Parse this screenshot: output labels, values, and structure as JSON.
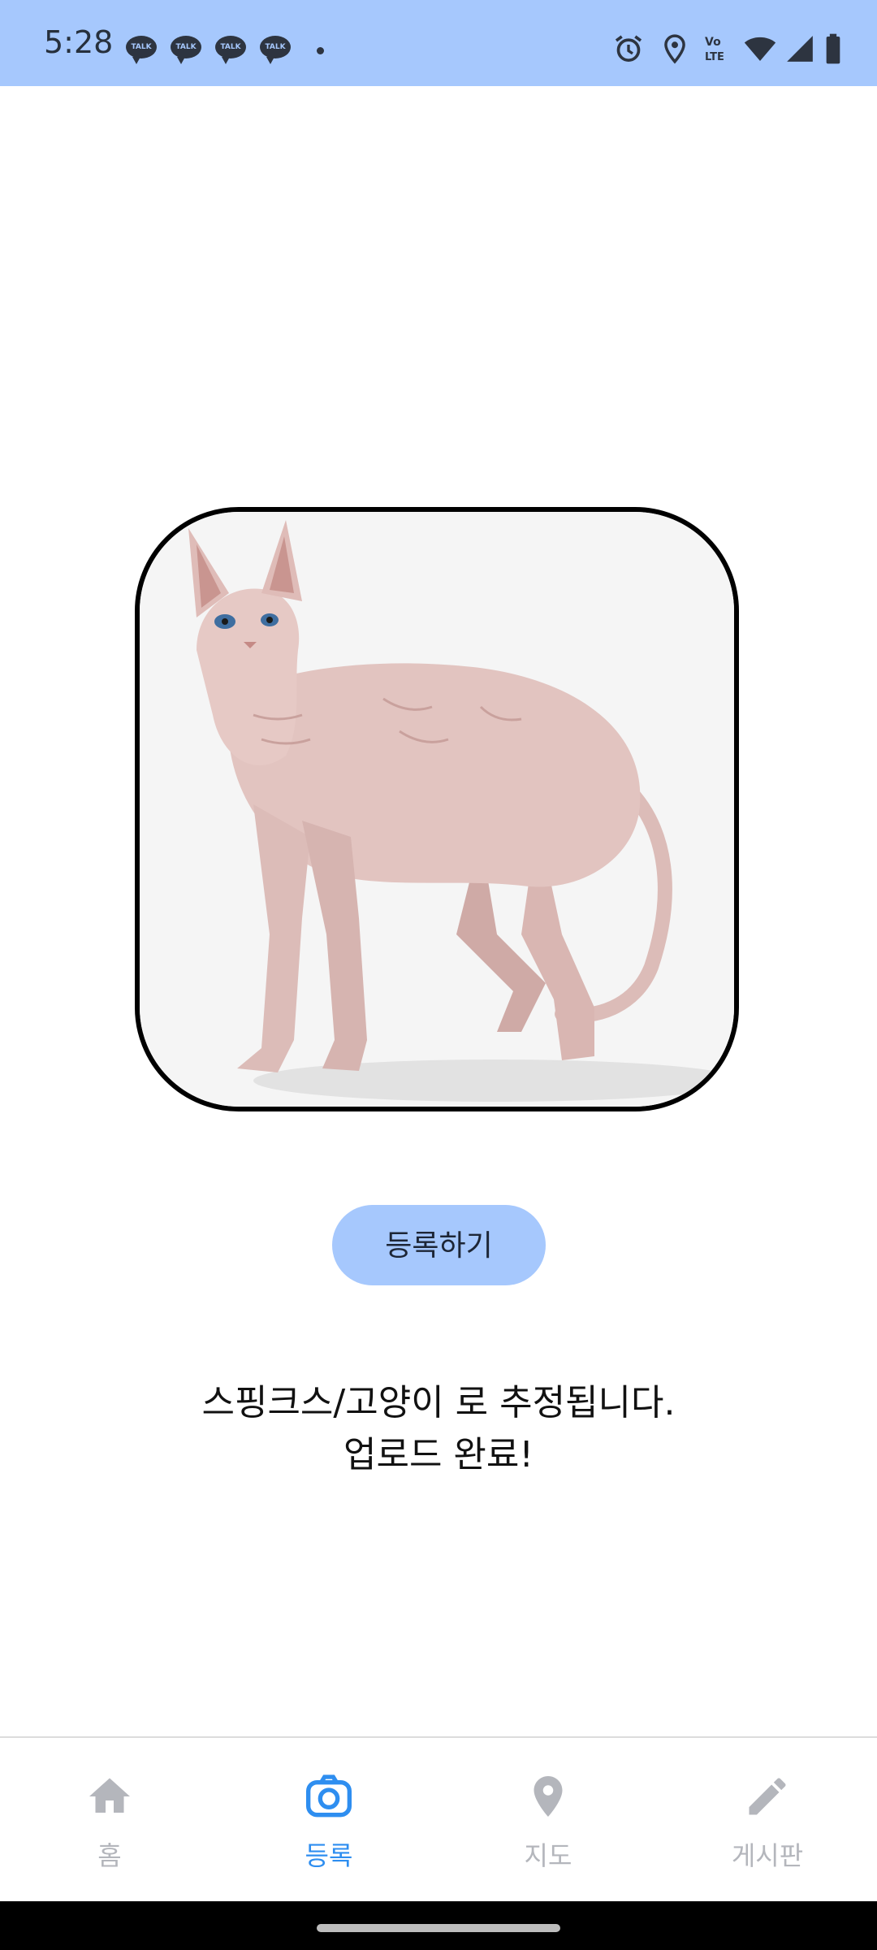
{
  "status_bar": {
    "time": "5:28",
    "notification_icons": [
      "TALK",
      "TALK",
      "TALK",
      "TALK"
    ],
    "right_icons": [
      "alarm-icon",
      "location-icon",
      "volte-icon",
      "wifi-icon",
      "signal-icon",
      "battery-icon"
    ],
    "volte_text_top": "Vo",
    "volte_text_bottom": "LTE"
  },
  "main": {
    "image_subject": "sphynx cat",
    "register_button_label": "등록하기",
    "result_line1": "스핑크스/고양이 로 추정됩니다.",
    "result_line2": "업로드 완료!"
  },
  "bottom_nav": {
    "items": [
      {
        "label": "홈",
        "icon": "home-icon",
        "active": false
      },
      {
        "label": "등록",
        "icon": "camera-icon",
        "active": true
      },
      {
        "label": "지도",
        "icon": "map-pin-icon",
        "active": false
      },
      {
        "label": "게시판",
        "icon": "pencil-icon",
        "active": false
      }
    ]
  },
  "colors": {
    "accent_bar": "#a6c8fd",
    "active_nav": "#2e8ef0",
    "inactive_nav": "#b4b6bc"
  }
}
